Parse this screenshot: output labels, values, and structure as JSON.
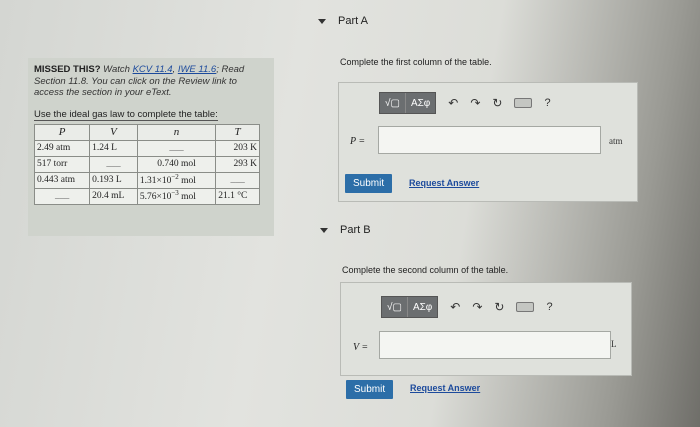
{
  "left": {
    "missed_label": "MISSED THIS?",
    "missed_watch": "Watch",
    "missed_link1": "KCV 11.4",
    "missed_link2": "IWE 11.6",
    "missed_text": "; Read Section 11.8. You can click on the Review link to access the section in your eText.",
    "instructions": "Use the ideal gas law to complete the table:",
    "table": {
      "headers": [
        "P",
        "V",
        "n",
        "T"
      ],
      "rows": [
        [
          "2.49 atm",
          "1.24 L",
          "",
          "203 K"
        ],
        [
          "517 torr",
          "",
          "0.740 mol",
          "293 K"
        ],
        [
          "0.443 atm",
          "0.193 L",
          "1.31×10",
          ""
        ],
        [
          "",
          "20.4 mL",
          "5.76×10",
          "21.1 °C"
        ]
      ],
      "row3_exp": "−2",
      "row3_unit": " mol",
      "row4_exp": "−3",
      "row4_unit": " mol"
    }
  },
  "partA": {
    "title": "Part A",
    "prompt": "Complete the first column of the table.",
    "toolbar": {
      "sqrt_label": "√▢",
      "greek_label": "ΑΣφ",
      "help_label": "?"
    },
    "var_label": "P =",
    "unit": "atm",
    "submit_label": "Submit",
    "request_label": "Request Answer"
  },
  "partB": {
    "title": "Part B",
    "prompt": "Complete the second column of the table.",
    "toolbar": {
      "sqrt_label": "√▢",
      "greek_label": "ΑΣφ",
      "help_label": "?"
    },
    "var_label": "V =",
    "unit": "L",
    "submit_label": "Submit",
    "request_label": "Request Answer"
  },
  "icons": [
    "undo-icon",
    "redo-icon",
    "reset-icon",
    "keyboard-icon",
    "help-icon",
    "caret-down-icon"
  ],
  "colors": {
    "submit": "#2c6ea8",
    "link": "#1c4a9c"
  }
}
